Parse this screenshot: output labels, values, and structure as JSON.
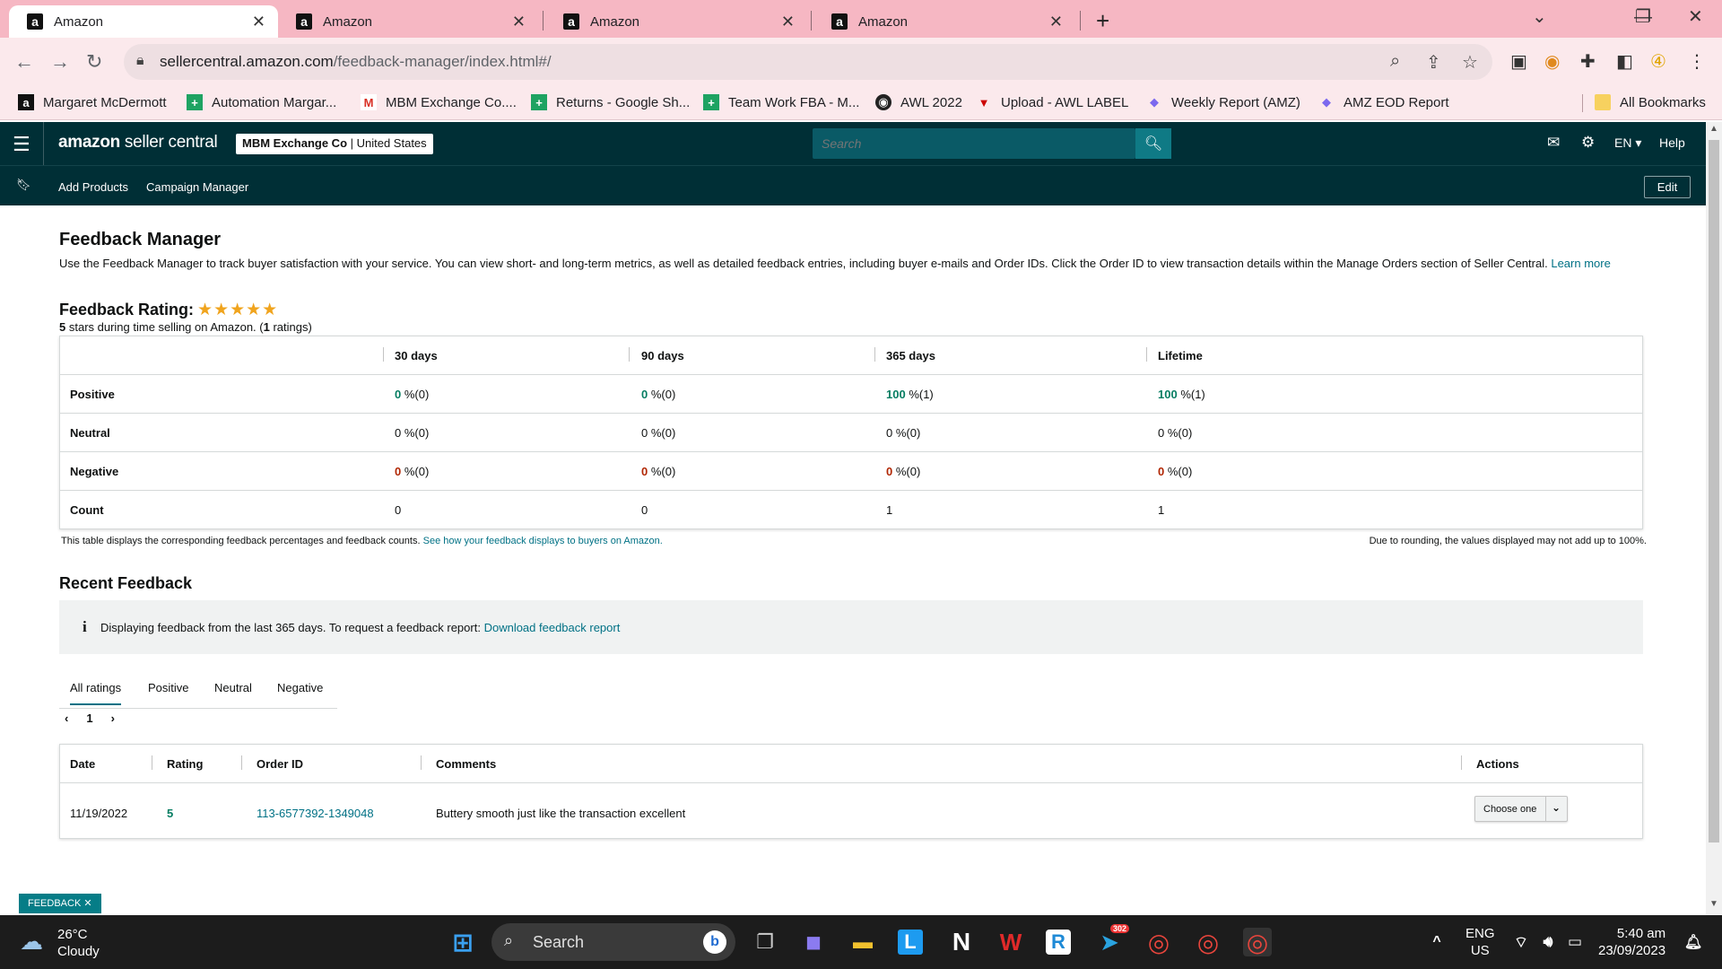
{
  "browser": {
    "tabs": [
      {
        "title": "Amazon",
        "favicon": "a"
      },
      {
        "title": "Amazon",
        "favicon": "a"
      },
      {
        "title": "Amazon",
        "favicon": "a"
      },
      {
        "title": "Amazon",
        "favicon": "a"
      }
    ],
    "url_domain": "sellercentral.amazon.com",
    "url_path": "/feedback-manager/index.html#/",
    "bookmarks": [
      {
        "label": "Margaret McDermott",
        "icon": "amazon-icon"
      },
      {
        "label": "Automation Margar...",
        "icon": "sheets-icon"
      },
      {
        "label": "MBM Exchange Co....",
        "icon": "gmail-icon"
      },
      {
        "label": "Returns - Google Sh...",
        "icon": "sheets-icon"
      },
      {
        "label": "Team Work FBA - M...",
        "icon": "sheets-icon"
      },
      {
        "label": "AWL 2022",
        "icon": "globe-icon"
      },
      {
        "label": "Upload - AWL LABEL",
        "icon": "upload-icon"
      },
      {
        "label": "Weekly Report (AMZ)",
        "icon": "clickup-icon"
      },
      {
        "label": "AMZ EOD Report",
        "icon": "clickup-icon"
      }
    ],
    "all_bookmarks": "All Bookmarks"
  },
  "header": {
    "logo_bold": "amazon",
    "logo_rest": " seller central",
    "account_name": "MBM Exchange Co",
    "account_region": " | United States",
    "search_placeholder": "Search",
    "language": "EN",
    "help": "Help"
  },
  "subnav": {
    "links": [
      "Add Products",
      "Campaign Manager"
    ],
    "edit": "Edit"
  },
  "page": {
    "title": "Feedback Manager",
    "intro": "Use the Feedback Manager to track buyer satisfaction with your service. You can view short- and long-term metrics, as well as detailed feedback entries, including buyer e-mails and Order IDs. Click the Order ID to view transaction details within the Manage Orders section of Seller Central.",
    "learn_more": "Learn more",
    "rating_title": "Feedback Rating:",
    "rating_stars": 5,
    "rating_stars_glyph": "★★★★★",
    "rating_sub_stars": "5",
    "rating_sub_text": " stars during time selling on Amazon. (",
    "rating_sub_count": "1",
    "rating_sub_end": " ratings)"
  },
  "feedback_table": {
    "columns": [
      "30 days",
      "90 days",
      "365 days",
      "Lifetime"
    ],
    "rows": [
      {
        "label": "Positive",
        "cells": [
          {
            "num": "0",
            "rest": " %(0)"
          },
          {
            "num": "0",
            "rest": " %(0)"
          },
          {
            "num": "100",
            "rest": " %(1)"
          },
          {
            "num": "100",
            "rest": " %(1)"
          }
        ]
      },
      {
        "label": "Neutral",
        "cells": [
          {
            "num": "0",
            "rest": " %(0)"
          },
          {
            "num": "0",
            "rest": " %(0)"
          },
          {
            "num": "0",
            "rest": " %(0)"
          },
          {
            "num": "0",
            "rest": " %(0)"
          }
        ]
      },
      {
        "label": "Negative",
        "cells": [
          {
            "num": "0",
            "rest": " %(0)"
          },
          {
            "num": "0",
            "rest": " %(0)"
          },
          {
            "num": "0",
            "rest": " %(0)"
          },
          {
            "num": "0",
            "rest": " %(0)"
          }
        ]
      },
      {
        "label": "Count",
        "cells": [
          {
            "num": "0",
            "rest": ""
          },
          {
            "num": "0",
            "rest": ""
          },
          {
            "num": "1",
            "rest": ""
          },
          {
            "num": "1",
            "rest": ""
          }
        ]
      }
    ],
    "note": "This table displays the corresponding feedback percentages and feedback counts.",
    "note_link": "See how your feedback displays to buyers on Amazon.",
    "rounding_note": "Due to rounding, the values displayed may not add up to 100%."
  },
  "recent": {
    "title": "Recent Feedback",
    "info_text": "Displaying feedback from the last 365 days. To request a feedback report:",
    "info_link": "Download feedback report",
    "tabs": [
      "All ratings",
      "Positive",
      "Neutral",
      "Negative"
    ],
    "page": "1",
    "columns": [
      "Date",
      "Rating",
      "Order ID",
      "Comments",
      "Actions"
    ],
    "rows": [
      {
        "date": "11/19/2022",
        "rating": "5",
        "order_id": "113-6577392-1349048",
        "comment": "Buttery smooth just like the transaction excellent",
        "action": "Choose one"
      }
    ]
  },
  "feedback_badge": "FEEDBACK ✕",
  "taskbar": {
    "temp": "26°C",
    "weather": "Cloudy",
    "search": "Search",
    "telegram_badge": "302",
    "lang": "ENG",
    "region": "US",
    "time": "5:40 am",
    "date": "23/09/2023"
  },
  "colors": {
    "tabbar": "#f6b7c3",
    "header": "#002f36",
    "link": "#007185",
    "positive": "#067d62",
    "negative": "#b12704",
    "star": "#f0a41e"
  }
}
